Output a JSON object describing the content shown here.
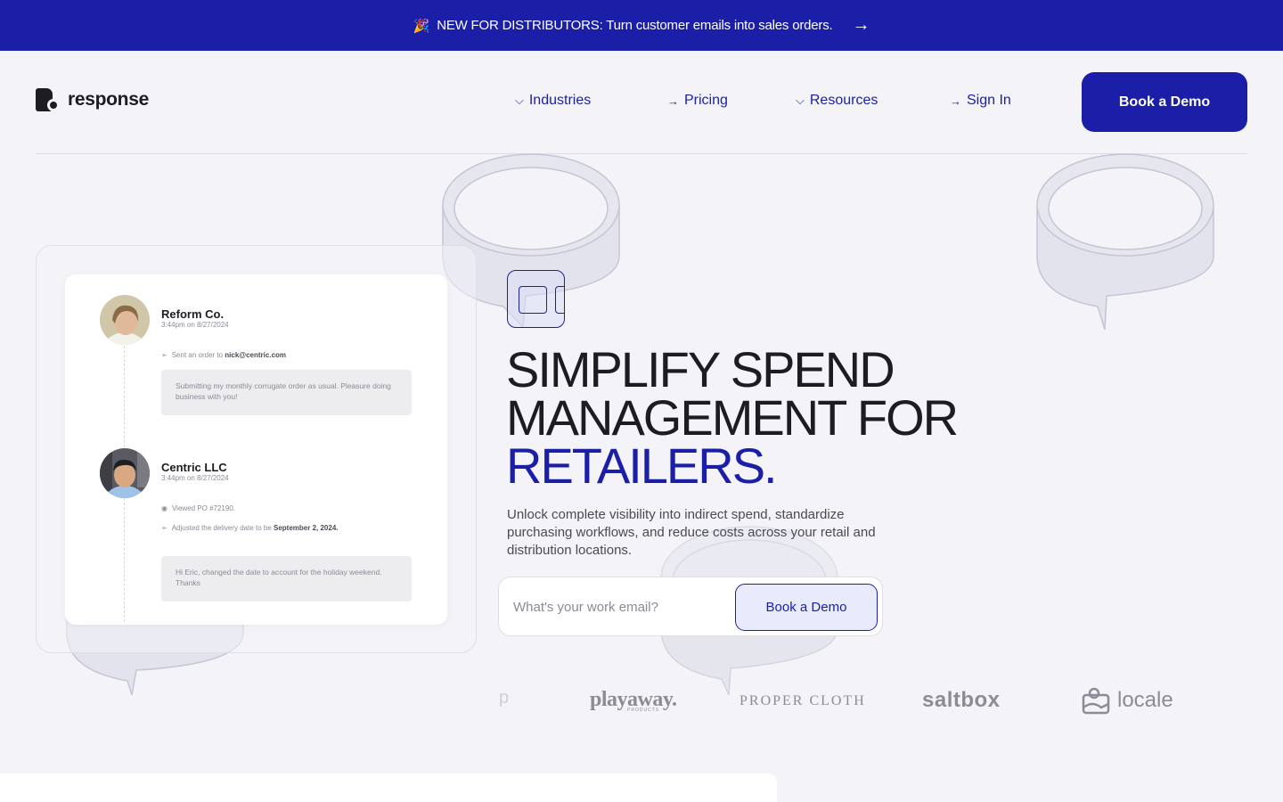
{
  "banner": {
    "emoji": "🎉",
    "text": "NEW FOR DISTRIBUTORS: Turn customer emails into sales orders.",
    "arrow": "→"
  },
  "brand": {
    "name": "response"
  },
  "nav": {
    "items": [
      {
        "label": "Industries",
        "icon": "chevron-down-icon",
        "glyph": "⌵"
      },
      {
        "label": "Pricing",
        "icon": "arrow-right-icon",
        "glyph": "→"
      },
      {
        "label": "Resources",
        "icon": "chevron-down-icon",
        "glyph": "⌵"
      },
      {
        "label": "Sign In",
        "icon": "arrow-right-icon",
        "glyph": "→"
      }
    ],
    "cta_label": "Book a Demo"
  },
  "activity": {
    "entries": [
      {
        "name": "Reform Co.",
        "time": "3:44pm on 8/27/2024",
        "lines": [
          {
            "icon": "send-icon",
            "glyph": "➢",
            "text": "Sent an order to ",
            "bold": "nick@centric.com"
          }
        ],
        "message": "Submitting my monthly corrugate order as usual. Pleasure doing business with you!"
      },
      {
        "name": "Centric LLC",
        "time": "3:44pm on 8/27/2024",
        "lines": [
          {
            "icon": "eye-icon",
            "glyph": "◉",
            "text": "Viewed PO #72190.",
            "bold": ""
          },
          {
            "icon": "send-icon",
            "glyph": "➢",
            "text": "Adjusted the delivery date to be ",
            "bold": "September 2, 2024."
          }
        ],
        "message": "Hi Eric, changed the date to account for the holiday weekend. Thanks"
      }
    ]
  },
  "hero": {
    "headline_line1": "SIMPLIFY SPEND",
    "headline_line2": "MANAGEMENT FOR",
    "headline_accent": "RETAILERS.",
    "subtext": "Unlock complete visibility into indirect spend, standardize purchasing workflows, and reduce costs across your retail and distribution locations.",
    "email_placeholder": "What's your work email?",
    "cta_label": "Book a Demo"
  },
  "logos": {
    "partial": "p",
    "playaway": "playaway.",
    "playaway_sub": "PRODUCTS",
    "proper_cloth": "PROPER CLOTH",
    "saltbox": "saltbox",
    "locale": "locale"
  },
  "colors": {
    "brand_blue": "#1b1fa8",
    "background": "#f3f3f8",
    "text_dark": "#1c1c22"
  }
}
